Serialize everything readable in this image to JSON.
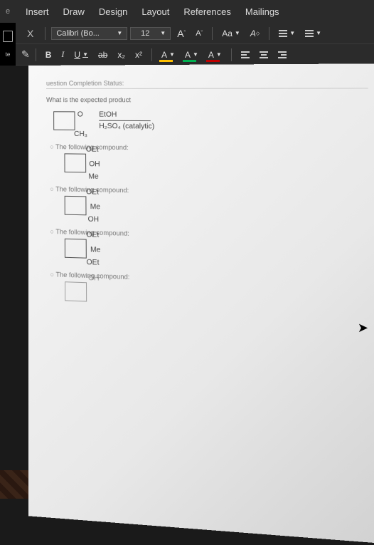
{
  "ribbon": {
    "tabs": [
      "Insert",
      "Draw",
      "Design",
      "Layout",
      "References",
      "Mailings"
    ],
    "font_name": "Calibri (Bo...",
    "font_size": "12",
    "cut": "X",
    "bold": "B",
    "italic": "I",
    "underline": "U",
    "strike": "ab",
    "subscript": "x₂",
    "superscript": "x²",
    "font_color": "A",
    "highlight": "A",
    "text_effects": "A",
    "grow_font": "A",
    "shrink_font": "A",
    "change_case": "Aa",
    "clear_format": "A"
  },
  "left": {
    "tab_partial": "e",
    "paste_label": "te"
  },
  "document": {
    "status": "uestion Completion Status:",
    "question": "What is the expected product",
    "reagent_top": "EtOH",
    "reagent_bottom": "H₂SO₄ (catalytic)",
    "start_o": "O",
    "start_ch3": "CH₃",
    "option_label": "The following compound:",
    "opt1_top": "OEt",
    "opt1_mid": "OH",
    "opt1_bot": "Me",
    "opt2_top": "OEt",
    "opt2_mid": "Me",
    "opt2_bot": "OH",
    "opt3_top": "OEt",
    "opt3_mid": "Me",
    "opt3_bot": "OEt",
    "opt4_top": "OH"
  }
}
